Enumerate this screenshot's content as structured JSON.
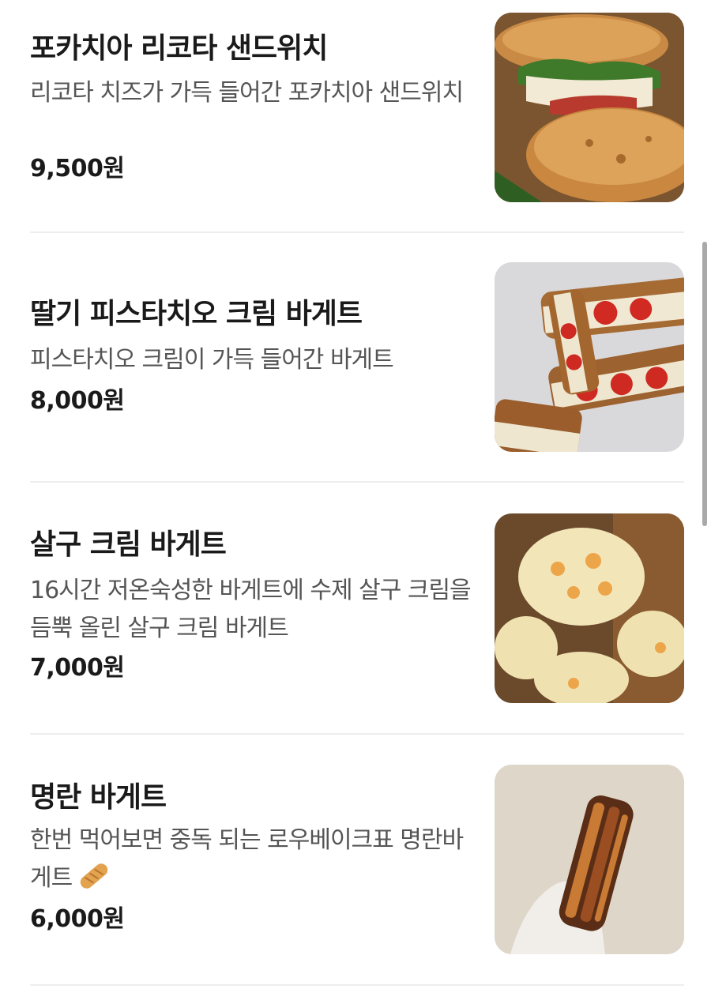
{
  "menu": {
    "items": [
      {
        "name": "포카치아 리코타 샌드위치",
        "description": "리코타 치즈가 가득 들어간 포카치아 샌드위치",
        "price": "9,500원",
        "image_icon": "focaccia-sandwich-photo"
      },
      {
        "name": "딸기 피스타치오 크림 바게트",
        "description": "피스타치오 크림이 가득 들어간 바게트",
        "price": "8,000원",
        "image_icon": "strawberry-baguette-photo"
      },
      {
        "name": "살구 크림 바게트",
        "description": "16시간 저온숙성한 바게트에 수제 살구 크림을 듬뿍 올린 살구 크림 바게트",
        "price": "7,000원",
        "image_icon": "apricot-cream-baguette-photo"
      },
      {
        "name": "명란 바게트",
        "description": "한번 먹어보면 중독 되는 로우베이크표 명란바게트",
        "description_emoji": "baguette-emoji",
        "price": "6,000원",
        "image_icon": "mentaiko-baguette-photo"
      }
    ]
  },
  "colors": {
    "title": "#1a1a1a",
    "description": "#555555",
    "divider": "#eeeeee",
    "scrollbar": "#a9a9a9"
  }
}
